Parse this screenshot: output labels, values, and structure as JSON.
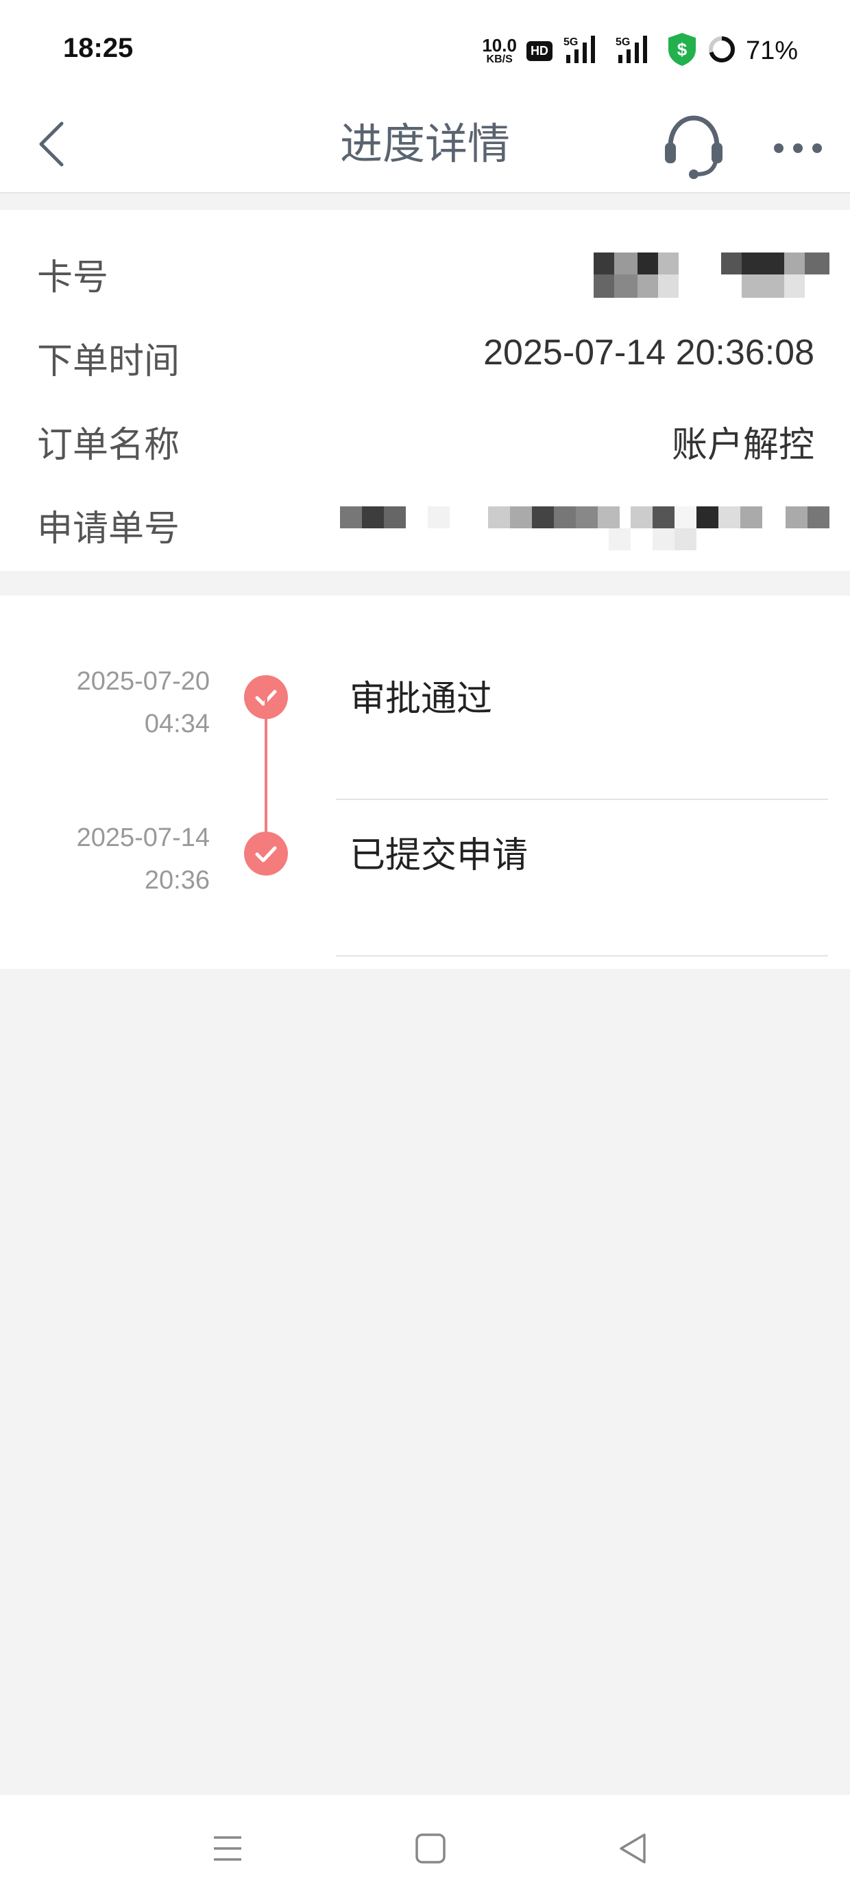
{
  "status_bar": {
    "time": "18:25",
    "net_speed_value": "10.0",
    "net_speed_unit": "KB/S",
    "hd_label": "HD",
    "signal1_label": "5G",
    "signal2_label": "5G",
    "battery_text": "71%",
    "icons": [
      "hd-icon",
      "signal-5g-icon",
      "signal-5g-icon",
      "security-shield-icon",
      "battery-ring-icon"
    ]
  },
  "header": {
    "title": "进度详情",
    "back_icon": "chevron-left-icon",
    "support_icon": "headset-icon",
    "more_icon": "more-dots-icon"
  },
  "info": {
    "card_no_label": "卡号",
    "order_time_label": "下单时间",
    "order_time_value": "2025-07-14 20:36:08",
    "order_name_label": "订单名称",
    "order_name_value": "账户解控",
    "application_no_label": "申请单号"
  },
  "progress": {
    "steps": [
      {
        "date": "2025-07-20",
        "time": "04:34",
        "title": "审批通过",
        "status": "completed"
      },
      {
        "date": "2025-07-14",
        "time": "20:36",
        "title": "已提交申请",
        "status": "completed"
      }
    ],
    "accent_color": "#f47c7c"
  },
  "nav_bar": {
    "icons": [
      "menu-icon",
      "home-square-icon",
      "back-triangle-icon"
    ]
  }
}
